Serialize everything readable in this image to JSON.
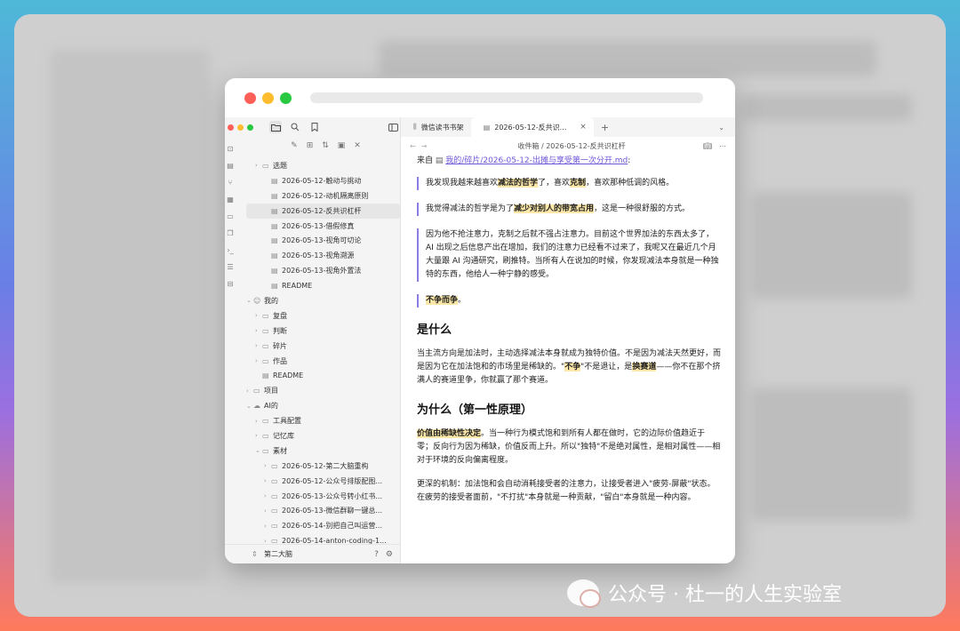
{
  "sidebar": {
    "ribbon_icons": [
      "bot-icon",
      "file-icon",
      "graph-icon",
      "grid-icon",
      "calendar-icon",
      "copy-icon",
      "terminal-icon",
      "list-icon",
      "book-icon"
    ],
    "tree": [
      {
        "label": "选题",
        "type": "folder",
        "level": 1,
        "expanded": false
      },
      {
        "label": "2026-05-12-触动与挑动",
        "type": "file",
        "level": 2
      },
      {
        "label": "2026-05-12-动机隔离原则",
        "type": "file",
        "level": 2
      },
      {
        "label": "2026-05-12-反共识杠杆",
        "type": "file",
        "level": 2,
        "selected": true
      },
      {
        "label": "2026-05-13-借假修真",
        "type": "file",
        "level": 2
      },
      {
        "label": "2026-05-13-视角可切论",
        "type": "file",
        "level": 2
      },
      {
        "label": "2026-05-13-视角溯源",
        "type": "file",
        "level": 2
      },
      {
        "label": "2026-05-13-视角外置法",
        "type": "file",
        "level": 2
      },
      {
        "label": "README",
        "type": "file",
        "level": 2
      },
      {
        "label": "我的",
        "type": "user",
        "level": 0,
        "expanded": true
      },
      {
        "label": "复盘",
        "type": "folder",
        "level": 1
      },
      {
        "label": "判断",
        "type": "folder",
        "level": 1
      },
      {
        "label": "碎片",
        "type": "folder",
        "level": 1
      },
      {
        "label": "作品",
        "type": "folder",
        "level": 1
      },
      {
        "label": "README",
        "type": "file",
        "level": 1
      },
      {
        "label": "项目",
        "type": "folder",
        "level": 0
      },
      {
        "label": "AI的",
        "type": "cloud",
        "level": 0,
        "expanded": true
      },
      {
        "label": "工具配置",
        "type": "folder",
        "level": 1
      },
      {
        "label": "记忆库",
        "type": "folder",
        "level": 1
      },
      {
        "label": "素材",
        "type": "folder",
        "level": 1,
        "expanded": true
      },
      {
        "label": "2026-05-12-第二大脑重构",
        "type": "folder",
        "level": 2
      },
      {
        "label": "2026-05-12-公众号排版配图...",
        "type": "folder",
        "level": 2
      },
      {
        "label": "2026-05-13-公众号转小红书...",
        "type": "folder",
        "level": 2
      },
      {
        "label": "2026-05-13-微信群聊一键总...",
        "type": "folder",
        "level": 2
      },
      {
        "label": "2026-05-14-别把自己叫运营...",
        "type": "folder",
        "level": 2
      },
      {
        "label": "2026-05-14-anton-coding-1...",
        "type": "folder",
        "level": 2
      }
    ],
    "vault_name": "第二大脑"
  },
  "tabs": [
    {
      "label": "微信读书书架",
      "active": false
    },
    {
      "label": "2026-05-12-反共识...",
      "active": true
    }
  ],
  "breadcrumb": {
    "folder": "收件箱",
    "sep": "/",
    "file": "2026-05-12-反共识杠杆"
  },
  "doc": {
    "from_label": "来自",
    "from_link": "我的/碎片/2026-05-12-出摊与享受第一次分开.md",
    "from_colon": ":",
    "q1_pre": "我发现我越来越喜欢",
    "q1_hl1": "减法的哲学",
    "q1_mid": "了，喜欢",
    "q1_hl2": "克制",
    "q1_post": "，喜欢那种低调的风格。",
    "q2_pre": "我觉得减法的哲学是为了",
    "q2_hl": "减少对别人的带宽占用",
    "q2_post": "，这是一种很舒服的方式。",
    "q3": "因为他不抢注意力，克制之后就不强占注意力。目前这个世界加法的东西太多了，AI 出现之后信息产出在增加，我们的注意力已经看不过来了，我呢又在最近几个月大量跟 AI 沟通研究，刷推特。当所有人在说加的时候，你发现减法本身就是一种独特的东西，他给人一种宁静的感受。",
    "q4_hl": "不争而争",
    "q4_post": "。",
    "h_what": "是什么",
    "p_what_1": "当主流方向是加法时，主动选择减法本身就成为独特价值。不是因为减法天然更好，而是因为它在加法饱和的市场里是稀缺的。\"",
    "p_what_hl1": "不争",
    "p_what_2": "\"不是退让，是",
    "p_what_hl2": "换赛道",
    "p_what_3": "——你不在那个挤满人的赛道里争，你就赢了那个赛道。",
    "h_why": "为什么（第一性原理）",
    "p_why_hl": "价值由稀缺性决定",
    "p_why": "。当一种行为模式饱和到所有人都在做时，它的边际价值趋近于零；反向行为因为稀缺，价值反而上升。所以\"独特\"不是绝对属性，是相对属性——相对于环境的反向偏离程度。",
    "p_deep": "更深的机制：加法饱和会自动消耗接受者的注意力，让接受者进入\"疲劳-屏蔽\"状态。在疲劳的接受者面前，\"不打扰\"本身就是一种贡献，\"留白\"本身就是一种内容。"
  },
  "watermark": "公众号 · 杜一的人生实验室",
  "colors": {
    "highlight": "#fbe8a8",
    "link": "#6f56d9",
    "quote_bar": "#8b7de6"
  }
}
